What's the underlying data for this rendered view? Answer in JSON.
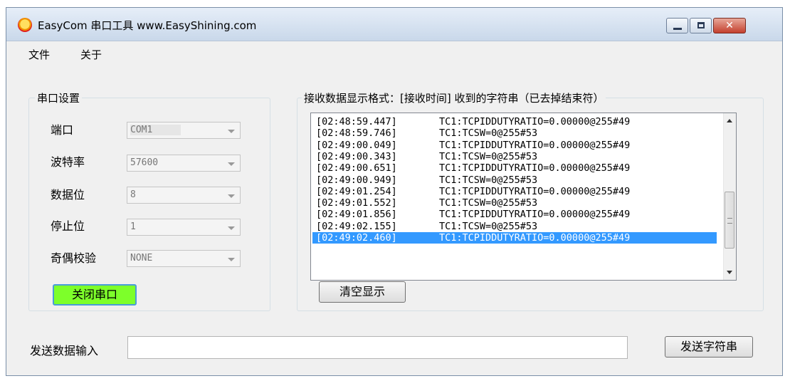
{
  "window": {
    "title": "EasyCom 串口工具   www.EasyShining.com",
    "close_glyph": "✕"
  },
  "menu": {
    "items": [
      "文件",
      "关于"
    ]
  },
  "serial_settings": {
    "title": "串口设置",
    "fields": [
      {
        "label": "端口",
        "value": "COM1"
      },
      {
        "label": "波特率",
        "value": "57600"
      },
      {
        "label": "数据位",
        "value": "8"
      },
      {
        "label": "停止位",
        "value": "1"
      },
      {
        "label": "奇偶校验",
        "value": "NONE"
      }
    ],
    "close_port_label": "关闭串口",
    "close_port_color": "#7dff2a"
  },
  "receive": {
    "title": "接收数据显示格式：[接收时间]   收到的字符串（已去掉结束符）",
    "rows": [
      {
        "time": "[02:48:59.447]",
        "msg": "TC1:TCPIDDUTYRATIO=0.00000@255#49"
      },
      {
        "time": "[02:48:59.746]",
        "msg": "TC1:TCSW=0@255#53"
      },
      {
        "time": "[02:49:00.049]",
        "msg": "TC1:TCPIDDUTYRATIO=0.00000@255#49"
      },
      {
        "time": "[02:49:00.343]",
        "msg": "TC1:TCSW=0@255#53"
      },
      {
        "time": "[02:49:00.651]",
        "msg": "TC1:TCPIDDUTYRATIO=0.00000@255#49"
      },
      {
        "time": "[02:49:00.949]",
        "msg": "TC1:TCSW=0@255#53"
      },
      {
        "time": "[02:49:01.254]",
        "msg": "TC1:TCPIDDUTYRATIO=0.00000@255#49"
      },
      {
        "time": "[02:49:01.552]",
        "msg": "TC1:TCSW=0@255#53"
      },
      {
        "time": "[02:49:01.856]",
        "msg": "TC1:TCPIDDUTYRATIO=0.00000@255#49"
      },
      {
        "time": "[02:49:02.155]",
        "msg": "TC1:TCSW=0@255#53"
      },
      {
        "time": "[02:49:02.460]",
        "msg": "TC1:TCPIDDUTYRATIO=0.00000@255#49"
      }
    ],
    "selected_row_color": "#3399ff",
    "clear_label": "清空显示"
  },
  "send": {
    "label": "发送数据输入",
    "input_value": "",
    "send_label": "发送字符串"
  }
}
